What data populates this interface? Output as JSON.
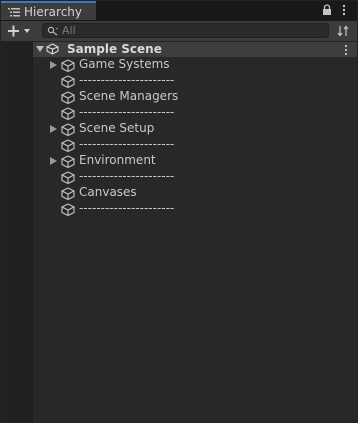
{
  "window": {
    "tab_title": "Hierarchy"
  },
  "toolbar": {
    "search_placeholder": "All"
  },
  "scene": {
    "name": "Sample Scene",
    "expanded": true
  },
  "items": [
    {
      "label": "Game Systems",
      "has_children": true
    },
    {
      "label": "----------------------",
      "has_children": false
    },
    {
      "label": "Scene Managers",
      "has_children": false
    },
    {
      "label": "----------------------",
      "has_children": false
    },
    {
      "label": "Scene Setup",
      "has_children": true
    },
    {
      "label": "----------------------",
      "has_children": false
    },
    {
      "label": "Environment",
      "has_children": true
    },
    {
      "label": "----------------------",
      "has_children": false
    },
    {
      "label": "Canvases",
      "has_children": false
    },
    {
      "label": "----------------------",
      "has_children": false
    }
  ],
  "icons": {
    "tab": "hierarchy-list-icon",
    "lock": "lock-icon",
    "menu": "kebab-menu-icon",
    "add": "plus-dropdown-icon",
    "search": "search-icon",
    "sort": "sort-icon",
    "scene": "unity-scene-icon",
    "gameobject": "cube-icon"
  },
  "colors": {
    "accent": "#3a79bb",
    "panel_bg": "#282828",
    "header_bg": "#3c3c3c",
    "scene_row_bg": "#3e3e3e"
  }
}
